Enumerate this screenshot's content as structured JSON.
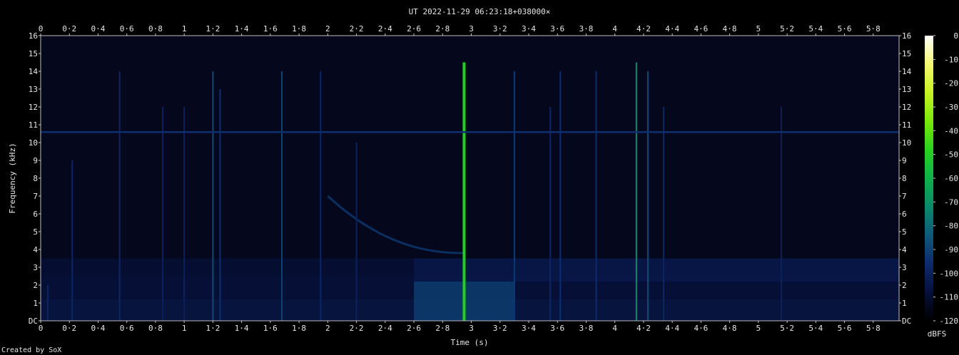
{
  "chart_data": {
    "type": "heatmap",
    "title": "UT 2022-11-29 06:23:18+038000×",
    "xlabel": "Time (s)",
    "ylabel": "Frequency (kHz)",
    "xlim": [
      0,
      5.98
    ],
    "ylim": [
      0,
      16
    ],
    "x_ticks": [
      "0",
      "0·2",
      "0·4",
      "0·6",
      "0·8",
      "1",
      "1·2",
      "1·4",
      "1·6",
      "1·8",
      "2",
      "2·2",
      "2·4",
      "2·6",
      "2·8",
      "3",
      "3·2",
      "3·4",
      "3·6",
      "3·8",
      "4",
      "4·2",
      "4·4",
      "4·6",
      "4·8",
      "5",
      "5·2",
      "5·4",
      "5·6",
      "5·8"
    ],
    "y_ticks": [
      "DC",
      "1",
      "2",
      "3",
      "4",
      "5",
      "6",
      "7",
      "8",
      "9",
      "10",
      "11",
      "12",
      "13",
      "14",
      "15",
      "16"
    ],
    "colorbar": {
      "label": "dBFS",
      "ticks": [
        "0",
        "-10",
        "-20",
        "-30",
        "-40",
        "-50",
        "-60",
        "-70",
        "-80",
        "-90",
        "-100",
        "-110",
        "-120"
      ],
      "range": [
        -120,
        0
      ]
    },
    "features": {
      "background_level_dbfs": -110,
      "horizontal_tone": {
        "freq_khz": 10.6,
        "level_dbfs": -95
      },
      "lowband_rise": {
        "from_time_s": 2.6,
        "to_time_s": 3.3,
        "top_khz": 3.5
      },
      "sweep": {
        "start_time_s": 2.0,
        "start_khz": 7.0,
        "end_time_s": 2.95,
        "end_khz": 3.8
      },
      "vertical_lines": [
        {
          "t": 0.05,
          "top_khz": 2.0,
          "level": -98
        },
        {
          "t": 0.22,
          "top_khz": 9.0,
          "level": -98
        },
        {
          "t": 0.55,
          "top_khz": 14.0,
          "level": -98
        },
        {
          "t": 0.85,
          "top_khz": 12.0,
          "level": -100
        },
        {
          "t": 1.0,
          "top_khz": 12.0,
          "level": -100
        },
        {
          "t": 1.2,
          "top_khz": 14.0,
          "level": -88
        },
        {
          "t": 1.25,
          "top_khz": 13.0,
          "level": -95
        },
        {
          "t": 1.68,
          "top_khz": 14.0,
          "level": -90
        },
        {
          "t": 1.95,
          "top_khz": 14.0,
          "level": -98
        },
        {
          "t": 2.2,
          "top_khz": 10.0,
          "level": -100
        },
        {
          "t": 2.95,
          "top_khz": 14.5,
          "level": -50
        },
        {
          "t": 3.3,
          "top_khz": 14.0,
          "level": -92
        },
        {
          "t": 3.55,
          "top_khz": 12.0,
          "level": -98
        },
        {
          "t": 3.62,
          "top_khz": 14.0,
          "level": -95
        },
        {
          "t": 3.87,
          "top_khz": 14.0,
          "level": -96
        },
        {
          "t": 4.15,
          "top_khz": 14.5,
          "level": -72
        },
        {
          "t": 4.23,
          "top_khz": 14.0,
          "level": -88
        },
        {
          "t": 4.34,
          "top_khz": 12.0,
          "level": -98
        },
        {
          "t": 5.16,
          "top_khz": 12.0,
          "level": -100
        }
      ]
    }
  },
  "footer": {
    "credit": "Created by SoX"
  }
}
